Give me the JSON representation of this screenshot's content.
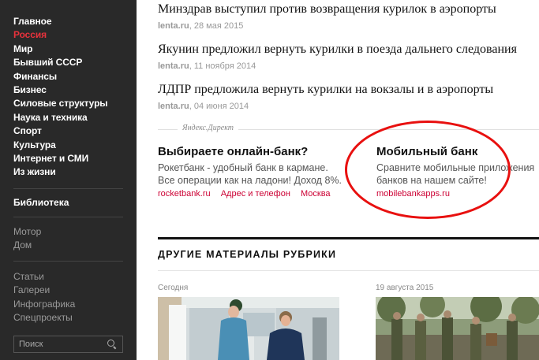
{
  "sidebar": {
    "nav": [
      {
        "label": "Главное",
        "active": false
      },
      {
        "label": "Россия",
        "active": true
      },
      {
        "label": "Мир",
        "active": false
      },
      {
        "label": "Бывший СССР",
        "active": false
      },
      {
        "label": "Финансы",
        "active": false
      },
      {
        "label": "Бизнес",
        "active": false
      },
      {
        "label": "Силовые структуры",
        "active": false
      },
      {
        "label": "Наука и техника",
        "active": false
      },
      {
        "label": "Спорт",
        "active": false
      },
      {
        "label": "Культура",
        "active": false
      },
      {
        "label": "Интернет и СМИ",
        "active": false
      },
      {
        "label": "Из жизни",
        "active": false
      }
    ],
    "library": "Библиотека",
    "group1": [
      "Мотор",
      "Дом"
    ],
    "group2": [
      "Статьи",
      "Галереи",
      "Инфографика",
      "Спецпроекты"
    ],
    "search_placeholder": "Поиск"
  },
  "news": [
    {
      "title": "Минздрав выступил против возвращения курилок в аэропорты",
      "source": "lenta.ru",
      "date": "28 мая 2015"
    },
    {
      "title": "Якунин предложил вернуть курилки в поезда дальнего следования",
      "source": "lenta.ru",
      "date": "11 ноября 2014"
    },
    {
      "title": "ЛДПР предложила вернуть курилки на вокзалы и в аэропорты",
      "source": "lenta.ru",
      "date": "04 июня 2014"
    }
  ],
  "direct": {
    "label": "Яндекс.Директ",
    "ads": [
      {
        "title": "Выбираете онлайн-банк?",
        "text1": "Рокетбанк - удобный банк в кармане.",
        "text2": "Все операции как на ладони! Доход 8%.",
        "links": [
          "rocketbank.ru",
          "Адрес и телефон",
          "Москва"
        ]
      },
      {
        "title": "Мобильный банк",
        "text1": "Сравните мобильные приложения",
        "text2": "банков на нашем сайте!",
        "links": [
          "mobilebankapps.ru"
        ]
      }
    ]
  },
  "section": {
    "title": "ДРУГИЕ МАТЕРИАЛЫ РУБРИКИ",
    "items": [
      {
        "date": "Сегодня"
      },
      {
        "date": "19 августа 2015"
      }
    ]
  },
  "colors": {
    "sidebar_bg": "#292929",
    "accent": "#e8323c",
    "ad_link": "#cc0033",
    "highlight_oval": "#e8100f"
  }
}
